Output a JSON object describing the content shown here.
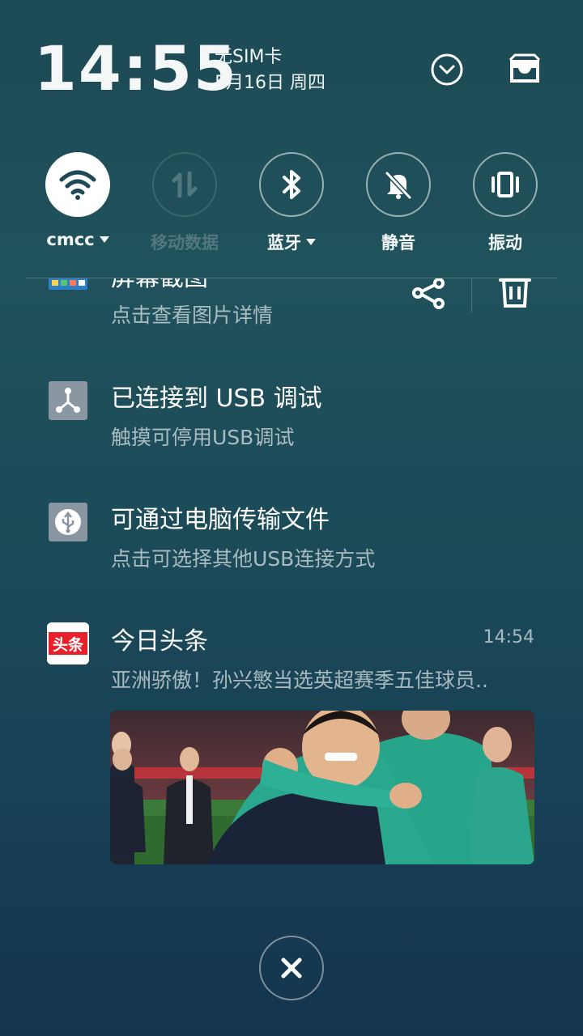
{
  "status": {
    "time": "14:55",
    "sim": "无SIM卡",
    "date": "5月16日 周四"
  },
  "toggles": [
    {
      "label": "cmcc",
      "icon": "wifi-icon",
      "state": "on",
      "dropdown": true
    },
    {
      "label": "移动数据",
      "icon": "mobile-data-icon",
      "state": "disabled",
      "dropdown": false
    },
    {
      "label": "蓝牙",
      "icon": "bluetooth-icon",
      "state": "off",
      "dropdown": true
    },
    {
      "label": "静音",
      "icon": "bell-off-icon",
      "state": "off",
      "dropdown": false
    },
    {
      "label": "振动",
      "icon": "vibrate-icon",
      "state": "off",
      "dropdown": false
    }
  ],
  "notifications": {
    "screenshot": {
      "title": "屏幕截图",
      "subtitle": "点击查看图片详情",
      "actions": [
        "share-icon",
        "trash-icon"
      ]
    },
    "usb_debug": {
      "title": "已连接到 USB 调试",
      "subtitle": "触摸可停用USB调试"
    },
    "usb_transfer": {
      "title": "可通过电脑传输文件",
      "subtitle": "点击可选择其他USB连接方式"
    },
    "news": {
      "app_badge": "头条",
      "title": "今日头条",
      "time": "14:54",
      "subtitle": "亚洲骄傲！孙兴慜当选英超赛季五佳球员.."
    }
  },
  "colors": {
    "background_top": "#1c4a55",
    "background_bottom": "#14354e",
    "toutiao_red": "#e8202a"
  }
}
